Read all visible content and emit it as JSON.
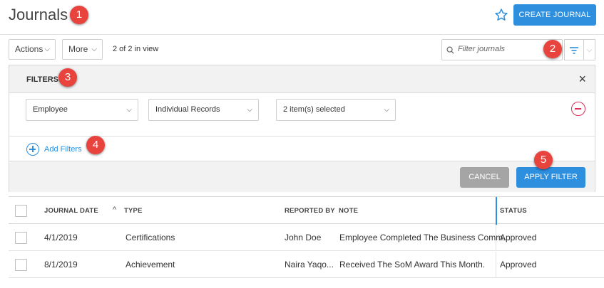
{
  "header": {
    "title": "Journals",
    "create_label": "CREATE JOURNAL"
  },
  "toolbar": {
    "actions_label": "Actions",
    "more_label": "More",
    "in_view_text": "2 of 2 in view",
    "search_placeholder": "Filter journals"
  },
  "filters": {
    "title": "FILTERS",
    "close_label": "×",
    "field_value": "Employee",
    "record_type_value": "Individual Records",
    "selection_value": "2 item(s) selected",
    "add_filters_label": "Add Filters",
    "cancel_label": "CANCEL",
    "apply_label": "APPLY FILTER"
  },
  "table": {
    "columns": [
      "JOURNAL DATE",
      "TYPE",
      "REPORTED BY",
      "NOTE",
      "STATUS"
    ],
    "sort_indicator": "^",
    "rows": [
      [
        "4/1/2019",
        "Certifications",
        "John Doe",
        "Employee Completed The Business Comm...",
        "Approved"
      ],
      [
        "8/1/2019",
        "Achievement",
        "Naira Yaqo...",
        "Received The SoM Award This Month.",
        "Approved"
      ]
    ]
  },
  "callouts": [
    "1",
    "2",
    "3",
    "4",
    "5"
  ],
  "colors": {
    "accent": "#2d8fde",
    "callout": "#e8433d",
    "remove": "#d7335b",
    "cancel": "#a5a5a5"
  },
  "icons": [
    "star-icon",
    "search-icon",
    "filter-icon",
    "chevron-down-icon",
    "close-icon",
    "remove-circle-icon",
    "add-circle-icon",
    "sort-up-icon"
  ]
}
